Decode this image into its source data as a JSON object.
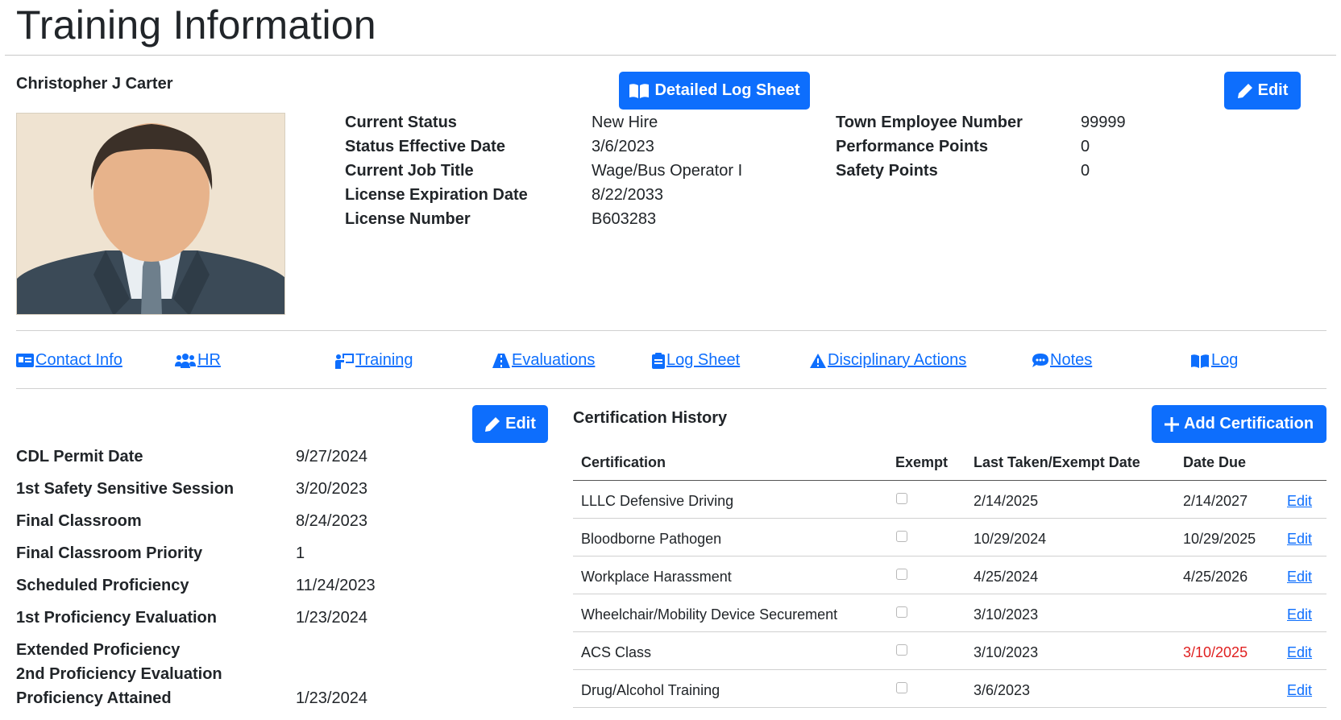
{
  "page": {
    "title": "Training Information"
  },
  "employee": {
    "name": "Christopher J Carter",
    "photo_alt": "employee photo",
    "buttons": {
      "log_sheet": "Detailed Log Sheet",
      "edit": "Edit"
    },
    "fields_left": [
      {
        "label": "Current Status",
        "value": "New Hire"
      },
      {
        "label": "Status Effective Date",
        "value": "3/6/2023"
      },
      {
        "label": "Current Job Title",
        "value": "Wage/Bus Operator I"
      },
      {
        "label": "License Expiration Date",
        "value": "8/22/2033"
      },
      {
        "label": "License Number",
        "value": "B603283"
      }
    ],
    "fields_right": [
      {
        "label": "Town Employee Number",
        "value": "99999"
      },
      {
        "label": "Performance Points",
        "value": "0"
      },
      {
        "label": "Safety Points",
        "value": "0"
      }
    ]
  },
  "nav": [
    {
      "label": "Contact Info",
      "icon": "id-card-icon"
    },
    {
      "label": "HR",
      "icon": "users-icon"
    },
    {
      "label": "Training",
      "icon": "chalkboard-teacher-icon"
    },
    {
      "label": "Evaluations",
      "icon": "road-icon"
    },
    {
      "label": "Log Sheet",
      "icon": "clipboard-icon"
    },
    {
      "label": "Disciplinary Actions",
      "icon": "warning-icon"
    },
    {
      "label": "Notes",
      "icon": "comment-dots-icon"
    },
    {
      "label": "Log",
      "icon": "book-open-icon"
    }
  ],
  "timeline": {
    "edit_label": "Edit",
    "rows": [
      {
        "label": "CDL Permit Date",
        "value": "9/27/2024"
      },
      {
        "label": "1st Safety Sensitive Session",
        "value": "3/20/2023"
      },
      {
        "label": "Final Classroom",
        "value": "8/24/2023"
      },
      {
        "label": "Final Classroom Priority",
        "value": "1"
      },
      {
        "label": "Scheduled Proficiency",
        "value": "11/24/2023"
      },
      {
        "label": "1st Proficiency Evaluation",
        "value": "1/23/2024"
      },
      {
        "label": "Extended Proficiency",
        "value": ""
      },
      {
        "label": "2nd Proficiency Evaluation",
        "value": ""
      },
      {
        "label": "Proficiency Attained",
        "value": "1/23/2024"
      }
    ]
  },
  "certifications": {
    "title": "Certification History",
    "add_label": "Add Certification",
    "columns": [
      "Certification",
      "Exempt",
      "Last Taken/Exempt Date",
      "Date Due"
    ],
    "rows": [
      {
        "name": "LLLC Defensive Driving",
        "exempt": false,
        "last": "2/14/2025",
        "due": "2/14/2027",
        "overdue": false,
        "action": "Edit"
      },
      {
        "name": "Bloodborne Pathogen",
        "exempt": false,
        "last": "10/29/2024",
        "due": "10/29/2025",
        "overdue": false,
        "action": "Edit"
      },
      {
        "name": "Workplace Harassment",
        "exempt": false,
        "last": "4/25/2024",
        "due": "4/25/2026",
        "overdue": false,
        "action": "Edit"
      },
      {
        "name": "Wheelchair/Mobility Device Securement",
        "exempt": false,
        "last": "3/10/2023",
        "due": "",
        "overdue": false,
        "action": "Edit"
      },
      {
        "name": "ACS Class",
        "exempt": false,
        "last": "3/10/2023",
        "due": "3/10/2025",
        "overdue": true,
        "action": "Edit"
      },
      {
        "name": "Drug/Alcohol Training",
        "exempt": false,
        "last": "3/6/2023",
        "due": "",
        "overdue": false,
        "action": "Edit"
      }
    ]
  },
  "colors": {
    "primary": "#0d6efd",
    "overdue": "#e02020"
  }
}
